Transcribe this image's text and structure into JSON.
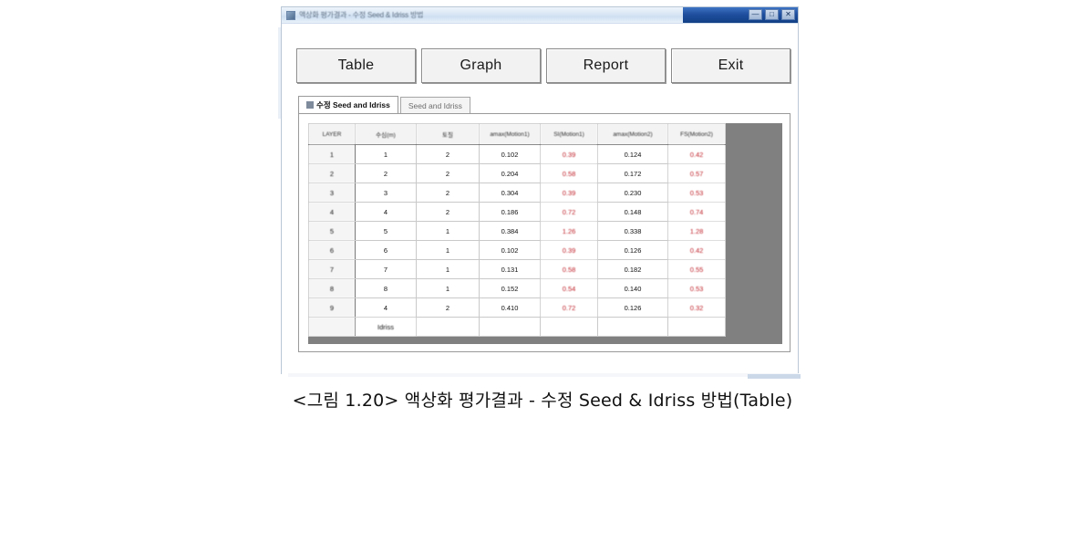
{
  "window": {
    "title": "액상화 평가결과 - 수정 Seed & Idriss 방법",
    "controls": {
      "minimize": "—",
      "maximize": "□",
      "close": "✕",
      "minimize_name": "minimize",
      "maximize_name": "maximize",
      "close_name": "close"
    },
    "app_icon": "app-icon"
  },
  "toolbar": {
    "buttons": [
      {
        "label": "Table"
      },
      {
        "label": "Graph"
      },
      {
        "label": "Report"
      },
      {
        "label": "Exit"
      }
    ]
  },
  "tabs": [
    {
      "label": "수정 Seed and Idriss",
      "active": true
    },
    {
      "label": "Seed and Idriss",
      "active": false
    }
  ],
  "table": {
    "headers": [
      "LAYER",
      "수심(m)",
      "토질",
      "amax(Motion1)",
      "SI(Motion1)",
      "amax(Motion2)",
      "FS(Motion2)"
    ],
    "rows": [
      {
        "layer": "1",
        "depth": "1",
        "soil": "2",
        "amax1": "0.102",
        "si1": "0.39",
        "amax2": "0.124",
        "fs2": "0.42"
      },
      {
        "layer": "2",
        "depth": "2",
        "soil": "2",
        "amax1": "0.204",
        "si1": "0.58",
        "amax2": "0.172",
        "fs2": "0.57"
      },
      {
        "layer": "3",
        "depth": "3",
        "soil": "2",
        "amax1": "0.304",
        "si1": "0.39",
        "amax2": "0.230",
        "fs2": "0.53"
      },
      {
        "layer": "4",
        "depth": "4",
        "soil": "2",
        "amax1": "0.186",
        "si1": "0.72",
        "amax2": "0.148",
        "fs2": "0.74"
      },
      {
        "layer": "5",
        "depth": "5",
        "soil": "1",
        "amax1": "0.384",
        "si1": "1.26",
        "amax2": "0.338",
        "fs2": "1.28"
      },
      {
        "layer": "6",
        "depth": "6",
        "soil": "1",
        "amax1": "0.102",
        "si1": "0.39",
        "amax2": "0.126",
        "fs2": "0.42"
      },
      {
        "layer": "7",
        "depth": "7",
        "soil": "1",
        "amax1": "0.131",
        "si1": "0.58",
        "amax2": "0.182",
        "fs2": "0.55"
      },
      {
        "layer": "8",
        "depth": "8",
        "soil": "1",
        "amax1": "0.152",
        "si1": "0.54",
        "amax2": "0.140",
        "fs2": "0.53"
      },
      {
        "layer": "9",
        "depth": "4",
        "soil": "2",
        "amax1": "0.410",
        "si1": "0.72",
        "amax2": "0.126",
        "fs2": "0.32"
      }
    ],
    "footer_row": {
      "layer": "",
      "depth": "Idriss",
      "soil": "",
      "amax1": "",
      "si1": "",
      "amax2": "",
      "fs2": ""
    }
  },
  "caption": {
    "text": "<그림 1.20> 액상화 평가결과 - 수정 Seed & Idriss 방법(Table)"
  },
  "colors": {
    "accent_red": "#c0232b",
    "grid_bg": "#808080",
    "titlebar_blue": "#1f4f9e"
  }
}
